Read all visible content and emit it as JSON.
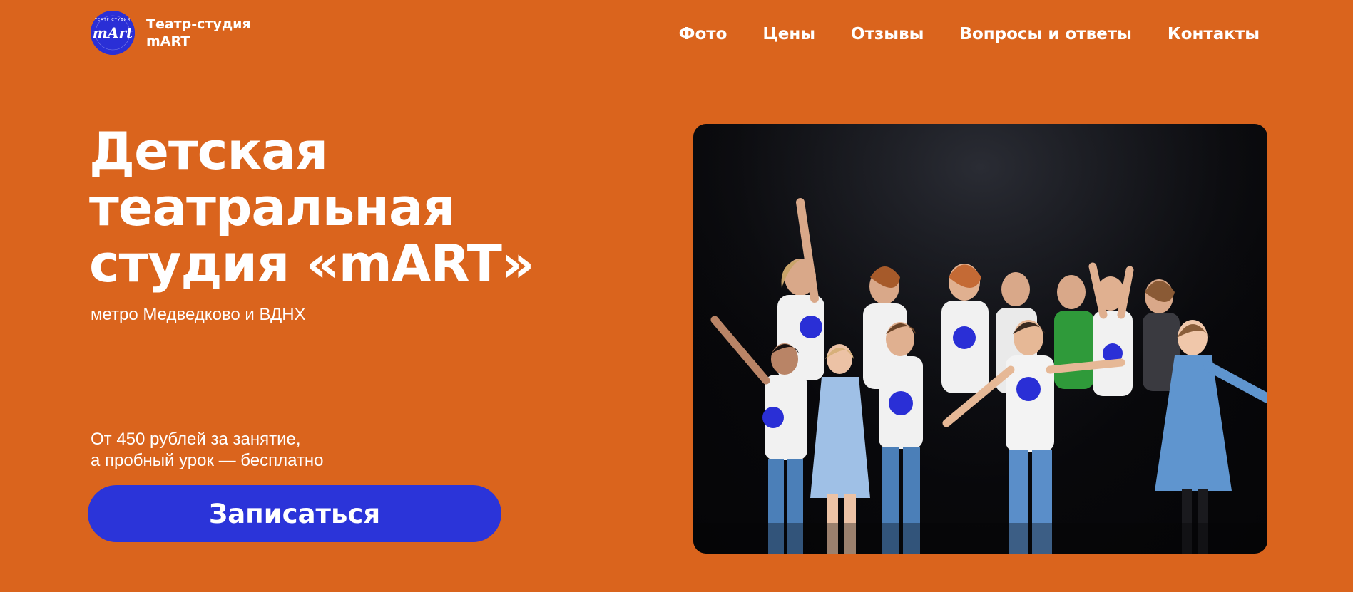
{
  "header": {
    "brand": "Театр-студия mART",
    "logo": {
      "icon": "mart-logo-icon",
      "text": "mArt",
      "ring_text": "ТЕАТР СТУДИЯ",
      "color": "#2a2fd6"
    },
    "nav": [
      {
        "label": "Фото"
      },
      {
        "label": "Цены"
      },
      {
        "label": "Отзывы"
      },
      {
        "label": "Вопросы и ответы"
      },
      {
        "label": "Контакты"
      }
    ]
  },
  "hero": {
    "title_lines": [
      "Детская",
      "театральная",
      "студия «mART»"
    ],
    "subtitle": "метро Медведково и ВДНХ",
    "price_lines": [
      "От 450 рублей за занятие,",
      "а пробный урок — бесплатно"
    ],
    "cta": "Записаться"
  },
  "photo": {
    "icon": "group-photo-icon"
  },
  "colors": {
    "background": "#da641d",
    "accent": "#2b34d9",
    "text": "#ffffff"
  }
}
